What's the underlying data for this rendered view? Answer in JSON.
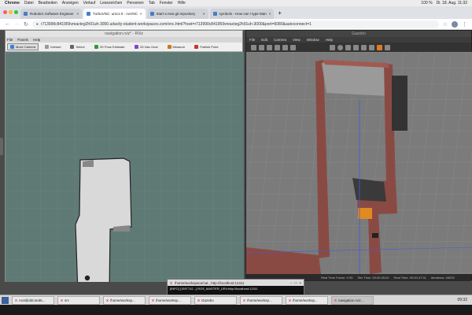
{
  "macbar": {
    "apple": "",
    "items": [
      "Chrome",
      "Datei",
      "Bearbeiten",
      "Anzeigen",
      "Verlauf",
      "Lesezeichen",
      "Personen",
      "Tab",
      "Fenster",
      "Hilfe"
    ],
    "battery": "100 %",
    "clock": "Di. 18. Aug. 11:32"
  },
  "chrome": {
    "tabs": [
      {
        "label": "Robotics Software Engineer",
        "active": false
      },
      {
        "label": "TurboVNC: ursc1:0 - noVNC",
        "active": true
      },
      {
        "label": "Start a new git repository",
        "active": false
      },
      {
        "label": "symbols - How can I type Man",
        "active": false
      }
    ],
    "url": "r713990c841959vreacteg2h91uh-3000.udacity-student-workspaces.com/vnc.html?host=r713990c841959vreacteg2h91uh-3000&port=6080&autoconnect=1"
  },
  "rviz": {
    "title": "navigation.rviz* - RViz",
    "menu": [
      "File",
      "Panels",
      "Help"
    ],
    "tools": [
      {
        "label": "Move Camera",
        "active": true,
        "color": "#3b7dd8"
      },
      {
        "label": "Interact",
        "active": false,
        "color": "#999999"
      },
      {
        "label": "Select",
        "active": false,
        "color": "#666666"
      },
      {
        "label": "2D Pose Estimate",
        "active": false,
        "color": "#2e9b3a"
      },
      {
        "label": "2D Nav Goal",
        "active": false,
        "color": "#7a4bc7"
      },
      {
        "label": "Measure",
        "active": false,
        "color": "#c77a1b"
      },
      {
        "label": "Publish Point",
        "active": false,
        "color": "#c0392b"
      }
    ]
  },
  "gazebo": {
    "title": "Gazebo",
    "menu": [
      "File",
      "Edit",
      "Camera",
      "View",
      "Window",
      "Help"
    ],
    "status": {
      "real_time": "Real Time Factor: 0.95",
      "sim_time": "Sim Time: 00:00:45:20",
      "real_time_clock": "Real Time: 00:00:47:31",
      "iterations": "Iterations: 45203"
    }
  },
  "terminal": {
    "title": "/home/workspace/cat...http://localhost:11311",
    "body": "[INFO] [1597742...] ROS_MASTER_URI=http://localhost:11311"
  },
  "taskbar": {
    "items": [
      {
        "label": "root@ddc4ed6...",
        "active": false
      },
      {
        "label": "src",
        "active": false
      },
      {
        "label": "/home/worksp...",
        "active": false
      },
      {
        "label": "/home/worksp...",
        "active": false
      },
      {
        "label": "Gazebo",
        "active": false
      },
      {
        "label": "/home/worksp...",
        "active": false
      },
      {
        "label": "/home/worksp...",
        "active": false
      },
      {
        "label": "navigation.rviz...",
        "active": true
      }
    ],
    "clock": "09:32"
  }
}
